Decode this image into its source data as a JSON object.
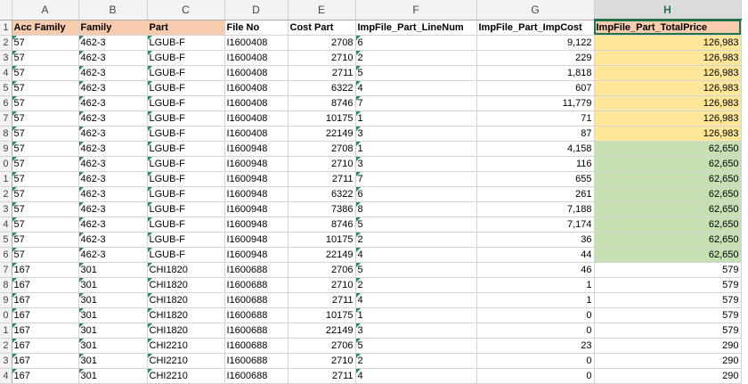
{
  "columns": [
    "A",
    "B",
    "C",
    "D",
    "E",
    "F",
    "G",
    "H"
  ],
  "active_column": "H",
  "headers": [
    "Acc Family",
    "Family",
    "Part",
    "File No",
    "Cost Part",
    "ImpFile_Part_LineNum",
    "ImpFile_Part_ImpCost",
    "ImpFile_Part_TotalPrice"
  ],
  "row_numbers": [
    "1",
    "2",
    "3",
    "4",
    "5",
    "6",
    "7",
    "8",
    "9",
    "0",
    "1",
    "2",
    "3",
    "4",
    "5",
    "6",
    "7",
    "8",
    "9",
    "0",
    "1",
    "2",
    "3",
    "4"
  ],
  "rows": [
    [
      "57",
      "462-3",
      "LGUB-F",
      "I1600408",
      "2708",
      "6",
      "9,122",
      "126,983",
      "yellow"
    ],
    [
      "57",
      "462-3",
      "LGUB-F",
      "I1600408",
      "2710",
      "2",
      "229",
      "126,983",
      "yellow"
    ],
    [
      "57",
      "462-3",
      "LGUB-F",
      "I1600408",
      "2711",
      "5",
      "1,818",
      "126,983",
      "yellow"
    ],
    [
      "57",
      "462-3",
      "LGUB-F",
      "I1600408",
      "6322",
      "4",
      "607",
      "126,983",
      "yellow"
    ],
    [
      "57",
      "462-3",
      "LGUB-F",
      "I1600408",
      "8746",
      "7",
      "11,779",
      "126,983",
      "yellow"
    ],
    [
      "57",
      "462-3",
      "LGUB-F",
      "I1600408",
      "10175",
      "1",
      "71",
      "126,983",
      "yellow"
    ],
    [
      "57",
      "462-3",
      "LGUB-F",
      "I1600408",
      "22149",
      "3",
      "87",
      "126,983",
      "yellow"
    ],
    [
      "57",
      "462-3",
      "LGUB-F",
      "I1600948",
      "2708",
      "1",
      "4,158",
      "62,650",
      "green"
    ],
    [
      "57",
      "462-3",
      "LGUB-F",
      "I1600948",
      "2710",
      "3",
      "116",
      "62,650",
      "green"
    ],
    [
      "57",
      "462-3",
      "LGUB-F",
      "I1600948",
      "2711",
      "7",
      "655",
      "62,650",
      "green"
    ],
    [
      "57",
      "462-3",
      "LGUB-F",
      "I1600948",
      "6322",
      "6",
      "261",
      "62,650",
      "green"
    ],
    [
      "57",
      "462-3",
      "LGUB-F",
      "I1600948",
      "7386",
      "8",
      "7,188",
      "62,650",
      "green"
    ],
    [
      "57",
      "462-3",
      "LGUB-F",
      "I1600948",
      "8746",
      "5",
      "7,174",
      "62,650",
      "green"
    ],
    [
      "57",
      "462-3",
      "LGUB-F",
      "I1600948",
      "10175",
      "2",
      "36",
      "62,650",
      "green"
    ],
    [
      "57",
      "462-3",
      "LGUB-F",
      "I1600948",
      "22149",
      "4",
      "44",
      "62,650",
      "green"
    ],
    [
      "167",
      "301",
      "CHI1820",
      "I1600688",
      "2706",
      "5",
      "46",
      "579",
      ""
    ],
    [
      "167",
      "301",
      "CHI1820",
      "I1600688",
      "2710",
      "2",
      "1",
      "579",
      ""
    ],
    [
      "167",
      "301",
      "CHI1820",
      "I1600688",
      "2711",
      "4",
      "1",
      "579",
      ""
    ],
    [
      "167",
      "301",
      "CHI1820",
      "I1600688",
      "10175",
      "1",
      "0",
      "579",
      ""
    ],
    [
      "167",
      "301",
      "CHI1820",
      "I1600688",
      "22149",
      "3",
      "0",
      "579",
      ""
    ],
    [
      "167",
      "301",
      "CHI2210",
      "I1600688",
      "2706",
      "5",
      "23",
      "290",
      ""
    ],
    [
      "167",
      "301",
      "CHI2210",
      "I1600688",
      "2710",
      "2",
      "0",
      "290",
      ""
    ],
    [
      "167",
      "301",
      "CHI2210",
      "I1600688",
      "2711",
      "4",
      "0",
      "290",
      ""
    ]
  ],
  "colors": {
    "header_fill": "#f8cbad",
    "yellow_fill": "#ffe699",
    "green_fill": "#c6e0b4",
    "excel_green": "#217346"
  }
}
